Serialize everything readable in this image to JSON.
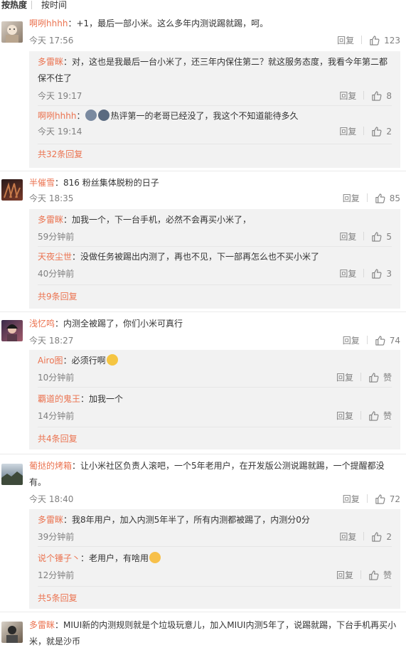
{
  "sort": {
    "hot": "按热度",
    "time": "按时间"
  },
  "labels": {
    "reply": "回复"
  },
  "icons": {
    "like": "thumbs-up-icon"
  },
  "colors": {
    "username": "#eb7350",
    "meta": "#808080",
    "reply_bg": "#f2f2f2"
  },
  "comments": [
    {
      "user": "啊咧hhhh",
      "text": "：+1，最后一部小米。这么多年内测说踢就踢，呵。",
      "time": "今天 17:56",
      "likes": "123",
      "replies": [
        {
          "user": "多雷眯",
          "text": "：对，这也是我最后一台小米了，还三年内保住第二？就这服务态度，我看今年第二都保不住了",
          "time": "今天 19:17",
          "likes": "8"
        },
        {
          "user": "啊咧hhhh",
          "text": "热评第一的老哥已经没了，我这个不知道能待多久",
          "time": "今天 19:14",
          "likes": "2"
        }
      ],
      "more": "共32条回复"
    },
    {
      "user": "半催雪",
      "text": "：816 粉丝集体脱粉的日子",
      "time": "今天 18:35",
      "likes": "85",
      "replies": [
        {
          "user": "多雷眯",
          "text": "：加我一个，下一台手机，必然不会再买小米了，",
          "time": "59分钟前",
          "likes": "5"
        },
        {
          "user": "天夜尘世",
          "text": "：没做任务被踢出内测了，再也不见，下一部再怎么也不买小米了",
          "time": "40分钟前",
          "likes": "3"
        }
      ],
      "more": "共9条回复"
    },
    {
      "user": "浅忆鸣",
      "text": "：内测全被踢了，你们小米可真行",
      "time": "今天 18:27",
      "likes": "74",
      "replies": [
        {
          "user": "Airo图",
          "text": "：必须行啊",
          "time": "10分钟前",
          "likes": "赞"
        },
        {
          "user": "覇道的鬼王",
          "text": "：加我一个",
          "time": "14分钟前",
          "likes": "赞"
        }
      ],
      "more": "共4条回复"
    },
    {
      "user": "葡挞的烤箱",
      "text": "：让小米社区负责人滚吧，一个5年老用户，在开发版公测说踢就踢，一个提醒都没有。",
      "time": "今天 18:40",
      "likes": "72",
      "replies": [
        {
          "user": "多雷眯",
          "text": "：我8年用户，加入内测5年半了，所有内测都被踢了，内测分0分",
          "time": "39分钟前",
          "likes": "2"
        },
        {
          "user": "说个锤子丶",
          "text": "：老用户，有啥用",
          "time": "12分钟前",
          "likes": "赞"
        }
      ],
      "more": "共5条回复"
    },
    {
      "user": "多雷眯",
      "text": "：MIUI新的内测规则就是个垃圾玩意儿，加入MIUI内测5年了，说踢就踢，下台手机再买小米，就是沙币"
    }
  ]
}
